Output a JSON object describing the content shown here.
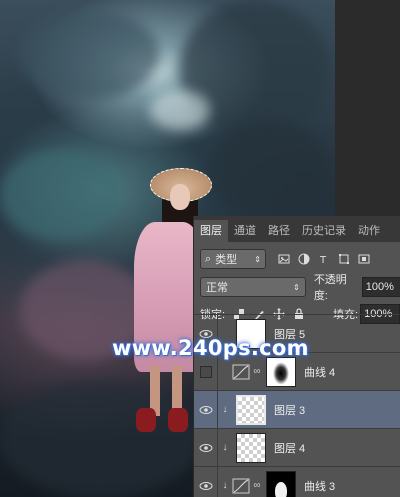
{
  "panel": {
    "tabs": [
      "图层",
      "通道",
      "路径",
      "历史记录",
      "动作"
    ],
    "filter": {
      "label": "类型"
    },
    "blend_mode": "正常",
    "opacity_label": "不透明度:",
    "opacity_value": "100%",
    "lock_label": "锁定:",
    "fill_label": "填充:",
    "fill_value": "100%",
    "layers": [
      {
        "name": "图层 5",
        "visible": true
      },
      {
        "name": "曲线 4",
        "visible": false,
        "kind": "curves"
      },
      {
        "name": "图层 3",
        "visible": true,
        "selected": true,
        "clipped": true
      },
      {
        "name": "图层 4",
        "visible": true,
        "clipped": true
      },
      {
        "name": "曲线 3",
        "visible": true,
        "kind": "curves",
        "clipped": true
      }
    ]
  },
  "watermark": "www.240ps.com",
  "colors": {
    "panel_bg": "#535353",
    "selected_layer": "#5f6b80",
    "tab_bar": "#383838"
  }
}
